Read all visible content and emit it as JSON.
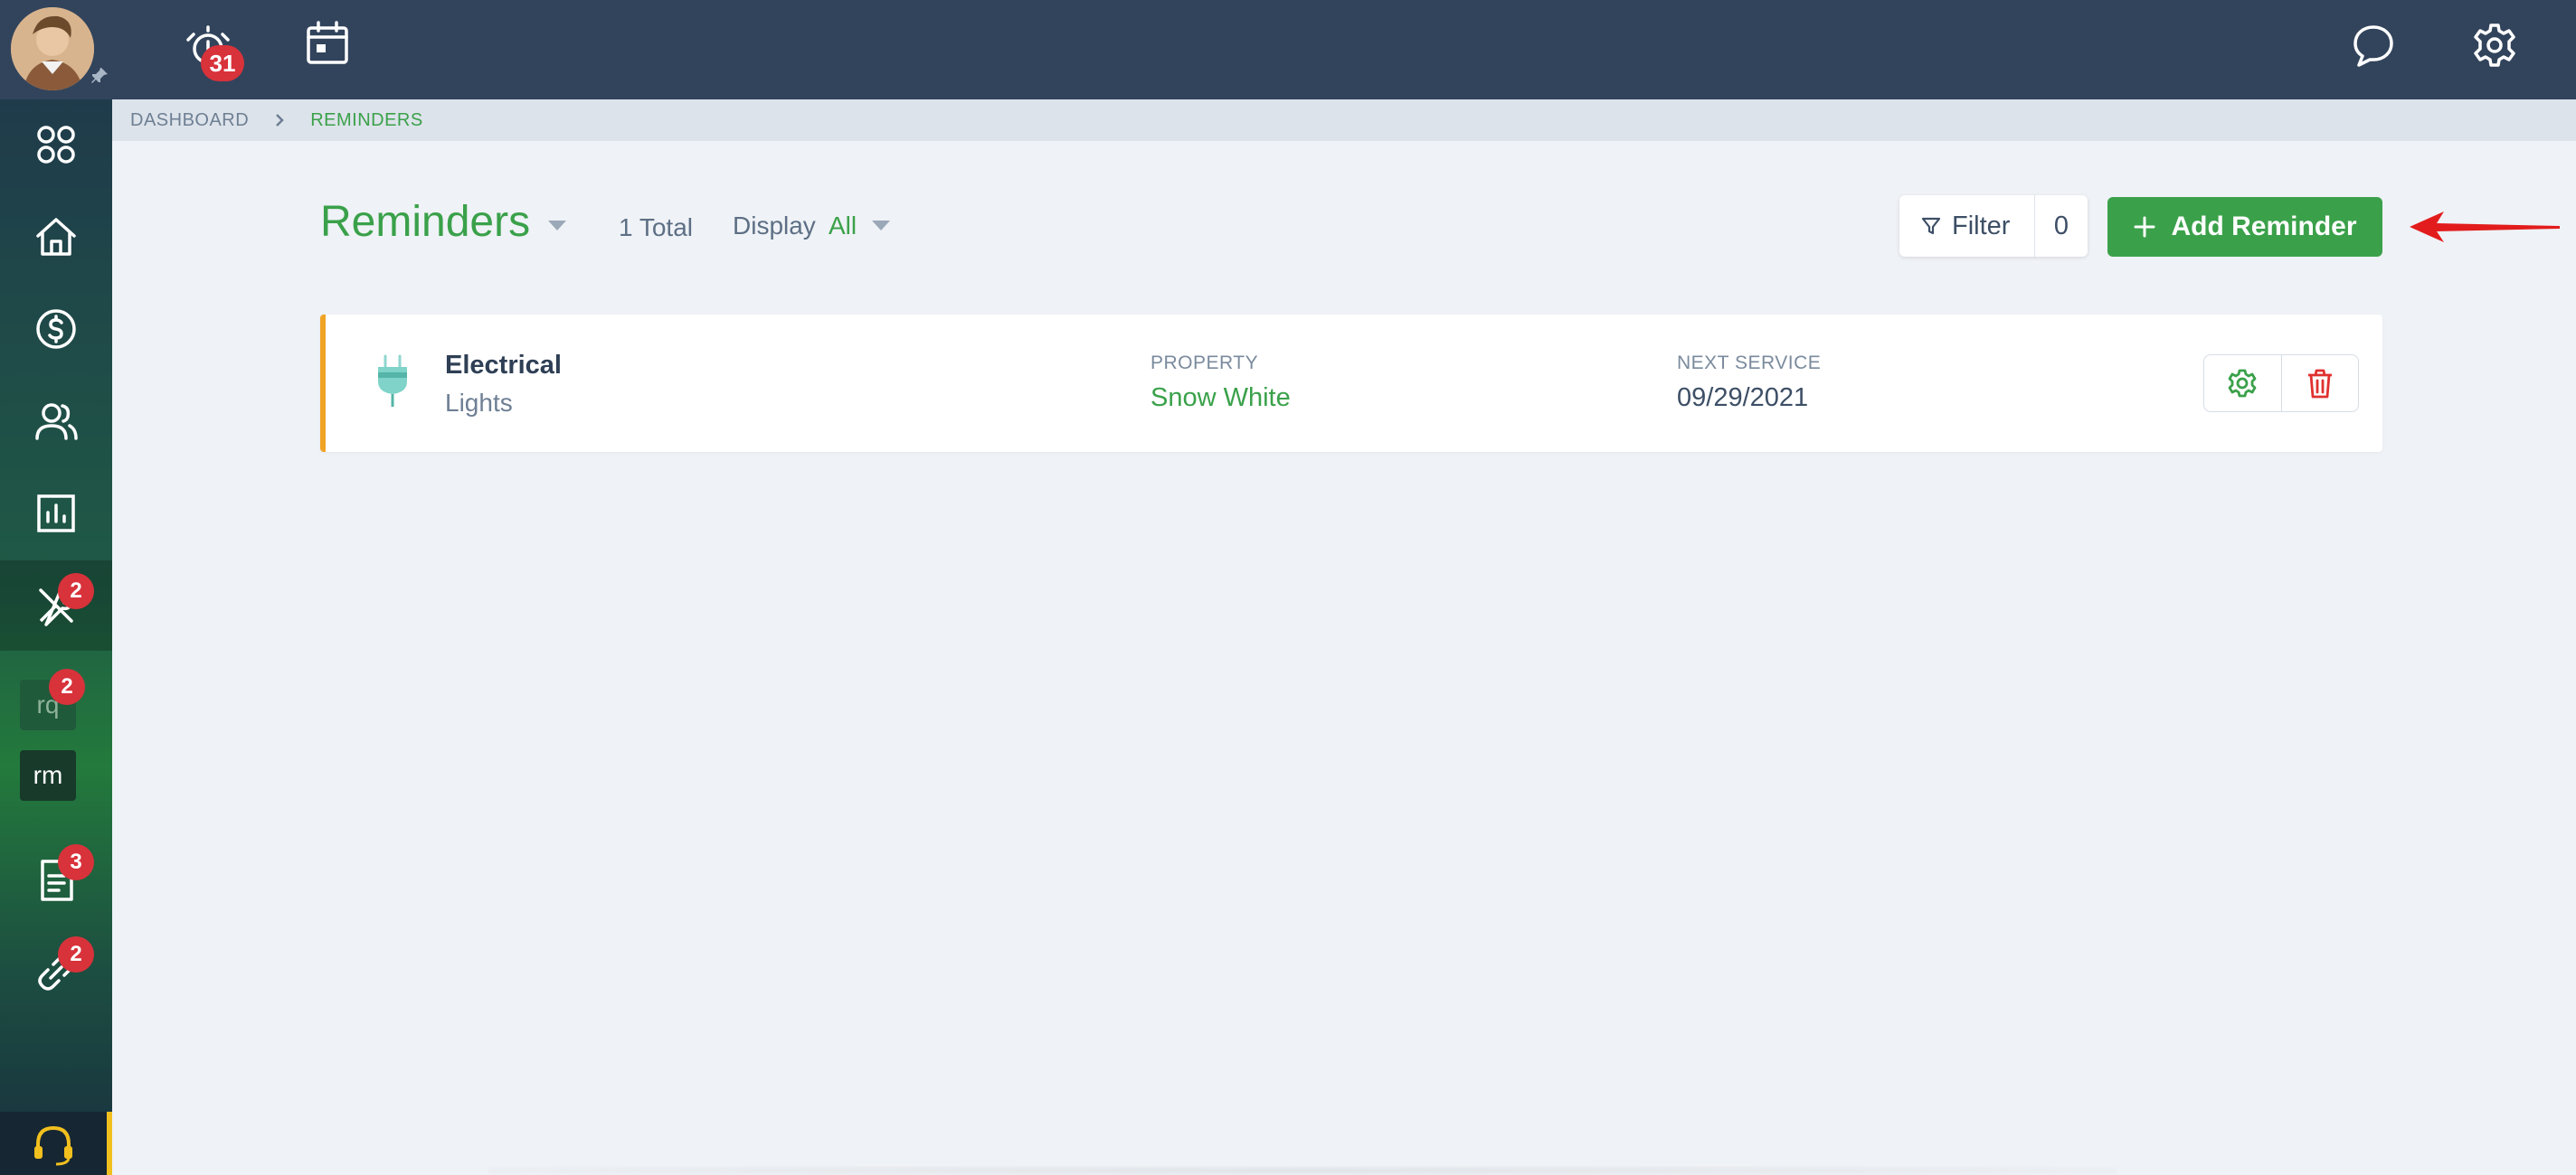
{
  "topbar": {
    "alarm_badge": "31",
    "icons": [
      "alarm-icon",
      "calendar-icon",
      "chat-icon",
      "settings-gear-icon"
    ]
  },
  "breadcrumb": {
    "items": [
      "DASHBOARD",
      "REMINDERS"
    ]
  },
  "sidebar": {
    "items": [
      {
        "name": "apps-grid-icon"
      },
      {
        "name": "home-icon"
      },
      {
        "name": "dollar-icon"
      },
      {
        "name": "people-icon"
      },
      {
        "name": "reports-icon"
      },
      {
        "name": "tools-icon",
        "badge": "2",
        "active": true
      },
      {
        "name": "rq",
        "label": "rq",
        "badge": "2"
      },
      {
        "name": "rm",
        "label": "rm"
      },
      {
        "name": "document-icon",
        "badge": "3"
      },
      {
        "name": "link-icon",
        "badge": "2"
      },
      {
        "name": "support-headset-icon"
      }
    ]
  },
  "header": {
    "title": "Reminders",
    "total": "1 Total",
    "display_label": "Display",
    "display_value": "All",
    "filter_label": "Filter",
    "filter_count": "0",
    "add_label": "Add Reminder"
  },
  "reminders": [
    {
      "category": "Electrical",
      "subcategory": "Lights",
      "property_label": "PROPERTY",
      "property": "Snow White",
      "next_service_label": "NEXT SERVICE",
      "next_service": "09/29/2021"
    }
  ],
  "colors": {
    "accent_green": "#3aa14a",
    "topbar": "#32445c",
    "badge_red": "#d8323b",
    "card_stripe": "#f0a324"
  }
}
